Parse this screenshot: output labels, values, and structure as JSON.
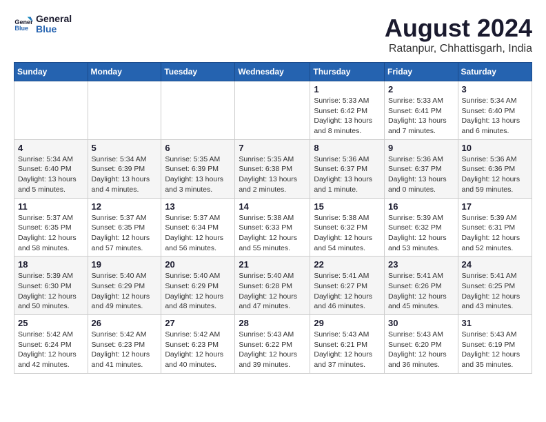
{
  "logo": {
    "line1": "General",
    "line2": "Blue"
  },
  "title": "August 2024",
  "subtitle": "Ratanpur, Chhattisgarh, India",
  "days_of_week": [
    "Sunday",
    "Monday",
    "Tuesday",
    "Wednesday",
    "Thursday",
    "Friday",
    "Saturday"
  ],
  "weeks": [
    [
      {
        "day": "",
        "info": ""
      },
      {
        "day": "",
        "info": ""
      },
      {
        "day": "",
        "info": ""
      },
      {
        "day": "",
        "info": ""
      },
      {
        "day": "1",
        "info": "Sunrise: 5:33 AM\nSunset: 6:42 PM\nDaylight: 13 hours\nand 8 minutes."
      },
      {
        "day": "2",
        "info": "Sunrise: 5:33 AM\nSunset: 6:41 PM\nDaylight: 13 hours\nand 7 minutes."
      },
      {
        "day": "3",
        "info": "Sunrise: 5:34 AM\nSunset: 6:40 PM\nDaylight: 13 hours\nand 6 minutes."
      }
    ],
    [
      {
        "day": "4",
        "info": "Sunrise: 5:34 AM\nSunset: 6:40 PM\nDaylight: 13 hours\nand 5 minutes."
      },
      {
        "day": "5",
        "info": "Sunrise: 5:34 AM\nSunset: 6:39 PM\nDaylight: 13 hours\nand 4 minutes."
      },
      {
        "day": "6",
        "info": "Sunrise: 5:35 AM\nSunset: 6:39 PM\nDaylight: 13 hours\nand 3 minutes."
      },
      {
        "day": "7",
        "info": "Sunrise: 5:35 AM\nSunset: 6:38 PM\nDaylight: 13 hours\nand 2 minutes."
      },
      {
        "day": "8",
        "info": "Sunrise: 5:36 AM\nSunset: 6:37 PM\nDaylight: 13 hours\nand 1 minute."
      },
      {
        "day": "9",
        "info": "Sunrise: 5:36 AM\nSunset: 6:37 PM\nDaylight: 13 hours\nand 0 minutes."
      },
      {
        "day": "10",
        "info": "Sunrise: 5:36 AM\nSunset: 6:36 PM\nDaylight: 12 hours\nand 59 minutes."
      }
    ],
    [
      {
        "day": "11",
        "info": "Sunrise: 5:37 AM\nSunset: 6:35 PM\nDaylight: 12 hours\nand 58 minutes."
      },
      {
        "day": "12",
        "info": "Sunrise: 5:37 AM\nSunset: 6:35 PM\nDaylight: 12 hours\nand 57 minutes."
      },
      {
        "day": "13",
        "info": "Sunrise: 5:37 AM\nSunset: 6:34 PM\nDaylight: 12 hours\nand 56 minutes."
      },
      {
        "day": "14",
        "info": "Sunrise: 5:38 AM\nSunset: 6:33 PM\nDaylight: 12 hours\nand 55 minutes."
      },
      {
        "day": "15",
        "info": "Sunrise: 5:38 AM\nSunset: 6:32 PM\nDaylight: 12 hours\nand 54 minutes."
      },
      {
        "day": "16",
        "info": "Sunrise: 5:39 AM\nSunset: 6:32 PM\nDaylight: 12 hours\nand 53 minutes."
      },
      {
        "day": "17",
        "info": "Sunrise: 5:39 AM\nSunset: 6:31 PM\nDaylight: 12 hours\nand 52 minutes."
      }
    ],
    [
      {
        "day": "18",
        "info": "Sunrise: 5:39 AM\nSunset: 6:30 PM\nDaylight: 12 hours\nand 50 minutes."
      },
      {
        "day": "19",
        "info": "Sunrise: 5:40 AM\nSunset: 6:29 PM\nDaylight: 12 hours\nand 49 minutes."
      },
      {
        "day": "20",
        "info": "Sunrise: 5:40 AM\nSunset: 6:29 PM\nDaylight: 12 hours\nand 48 minutes."
      },
      {
        "day": "21",
        "info": "Sunrise: 5:40 AM\nSunset: 6:28 PM\nDaylight: 12 hours\nand 47 minutes."
      },
      {
        "day": "22",
        "info": "Sunrise: 5:41 AM\nSunset: 6:27 PM\nDaylight: 12 hours\nand 46 minutes."
      },
      {
        "day": "23",
        "info": "Sunrise: 5:41 AM\nSunset: 6:26 PM\nDaylight: 12 hours\nand 45 minutes."
      },
      {
        "day": "24",
        "info": "Sunrise: 5:41 AM\nSunset: 6:25 PM\nDaylight: 12 hours\nand 43 minutes."
      }
    ],
    [
      {
        "day": "25",
        "info": "Sunrise: 5:42 AM\nSunset: 6:24 PM\nDaylight: 12 hours\nand 42 minutes."
      },
      {
        "day": "26",
        "info": "Sunrise: 5:42 AM\nSunset: 6:23 PM\nDaylight: 12 hours\nand 41 minutes."
      },
      {
        "day": "27",
        "info": "Sunrise: 5:42 AM\nSunset: 6:23 PM\nDaylight: 12 hours\nand 40 minutes."
      },
      {
        "day": "28",
        "info": "Sunrise: 5:43 AM\nSunset: 6:22 PM\nDaylight: 12 hours\nand 39 minutes."
      },
      {
        "day": "29",
        "info": "Sunrise: 5:43 AM\nSunset: 6:21 PM\nDaylight: 12 hours\nand 37 minutes."
      },
      {
        "day": "30",
        "info": "Sunrise: 5:43 AM\nSunset: 6:20 PM\nDaylight: 12 hours\nand 36 minutes."
      },
      {
        "day": "31",
        "info": "Sunrise: 5:43 AM\nSunset: 6:19 PM\nDaylight: 12 hours\nand 35 minutes."
      }
    ]
  ]
}
